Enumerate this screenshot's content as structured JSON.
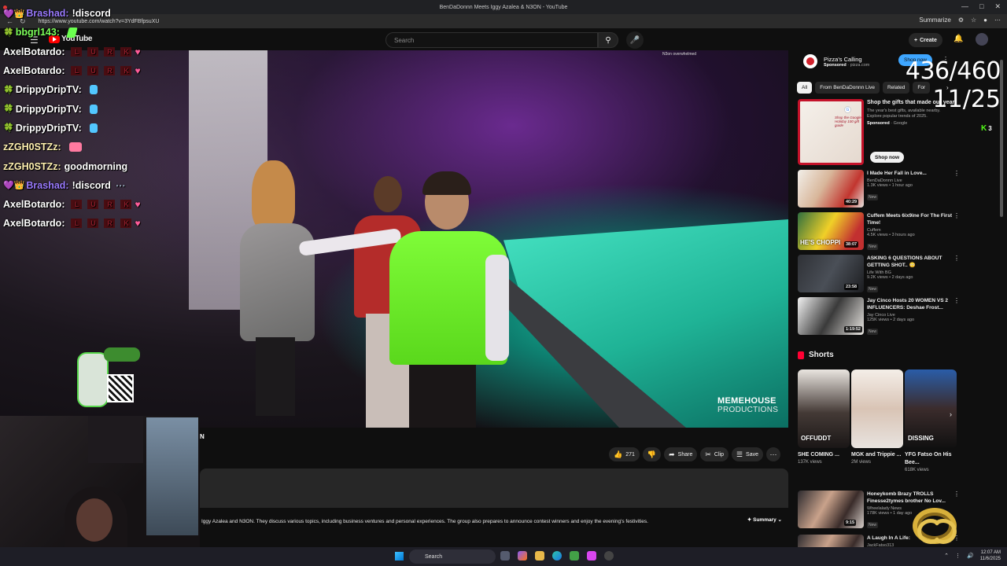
{
  "browser": {
    "tab_title": "BenDaDonnn Meets Iggy Azalea & N3ON - YouTube",
    "url": "https://www.youtube.com/watch?v=3YdFBfpsuXU",
    "summarize_label": "Summarize"
  },
  "youtube": {
    "logo_text": "YouTube",
    "search_placeholder": "Search",
    "create_label": "Create"
  },
  "video": {
    "overlay_text": "N3on overwhelmed",
    "watermark_line1": "MEMEHOUSE",
    "watermark_line2": "PRODUCTIONS",
    "title_fragment": "N",
    "likes": "271",
    "share_label": "Share",
    "clip_label": "Clip",
    "save_label": "Save",
    "summary_text": "Iggy Azalea and N3ON. They discuss various topics, including business ventures and personal experiences. The group also prepares to announce contest winners and enjoy the evening's festivities.",
    "summary_button": "Summary"
  },
  "chat": [
    {
      "user": "Brashad:",
      "msg": "!discord",
      "color": "#9b7bff",
      "badges": "💜👑",
      "emote": ""
    },
    {
      "user": "bbgrl143:",
      "msg": "",
      "color": "#7dff5a",
      "badges": "🍀",
      "emote": "green"
    },
    {
      "user": "AxelBotardo:",
      "msg": "",
      "color": "#ffffff",
      "badges": "",
      "emote": "lurk"
    },
    {
      "user": "AxelBotardo:",
      "msg": "",
      "color": "#ffffff",
      "badges": "",
      "emote": "lurk"
    },
    {
      "user": "DrippyDripTV:",
      "msg": "",
      "color": "#ffffff",
      "badges": "🍀",
      "emote": "cyan"
    },
    {
      "user": "DrippyDripTV:",
      "msg": "",
      "color": "#ffffff",
      "badges": "🍀",
      "emote": "cyan"
    },
    {
      "user": "DrippyDripTV:",
      "msg": "",
      "color": "#ffffff",
      "badges": "🍀",
      "emote": "cyan"
    },
    {
      "user": "zZGH0STZz:",
      "msg": "",
      "color": "#fff0b0",
      "badges": "",
      "emote": "sticker"
    },
    {
      "user": "zZGH0STZz:",
      "msg": "goodmorning",
      "color": "#fff0b0",
      "badges": "",
      "emote": ""
    },
    {
      "user": "Brashad:",
      "msg": "!discord",
      "color": "#9b7bff",
      "badges": "💜👑",
      "emote": "dots"
    },
    {
      "user": "AxelBotardo:",
      "msg": "",
      "color": "#ffffff",
      "badges": "",
      "emote": "lurk"
    },
    {
      "user": "AxelBotardo:",
      "msg": "",
      "color": "#ffffff",
      "badges": "",
      "emote": "lurk"
    }
  ],
  "lurk_letters": [
    "L",
    "U",
    "R",
    "K"
  ],
  "sidebar": {
    "ad1": {
      "title": "Pizza's Calling",
      "sponsored": "Sponsored",
      "domain": "pizza.com",
      "cta": "Shop now"
    },
    "chips": [
      "All",
      "From BenDaDonnn Live",
      "Related",
      "For"
    ],
    "ad2": {
      "title": "Shop the gifts that made our year",
      "desc": "The year's best gifts, available nearby. Explore popular trends of 2025.",
      "sponsored": "Sponsored",
      "advertiser": "Google",
      "cta": "Shop now",
      "thumb_text": "Shop the Google Holiday 100 gift guide"
    },
    "recs": [
      {
        "title": "I Made Her Fall in Love...",
        "channel": "BenDaDonnn Live",
        "meta": "1.3K views • 1 hour ago",
        "badge": "New",
        "duration": "40:29",
        "thumb_text": ""
      },
      {
        "title": "Cuffem Meets 6ix9ine For The First Time!",
        "channel": "Cuffem",
        "meta": "4.5K views • 3 hours ago",
        "badge": "New",
        "duration": "38:07",
        "thumb_text": "HE'S CHOPPI"
      },
      {
        "title": "ASKING 6 QUESTIONS ABOUT GETTING SHOT.. 😳",
        "channel": "Life With BG",
        "meta": "9.2K views • 2 days ago",
        "badge": "New",
        "duration": "23:58",
        "thumb_text": ""
      },
      {
        "title": "Jay Cinco Hosts 20 WOMEN VS 2 INFLUENCERS: Deshae Frost...",
        "channel": "Jay Cinco Live",
        "meta": "125K views • 2 days ago",
        "badge": "New",
        "duration": "1:19:52",
        "thumb_text": ""
      }
    ],
    "shorts_title": "Shorts",
    "shorts": [
      {
        "title": "SHE COMING ...",
        "views": "137K views",
        "thumb_text": "OFFUDDT"
      },
      {
        "title": "MGK and Trippie ...",
        "views": "2M views",
        "thumb_text": ""
      },
      {
        "title": "YFG Fatso On His Bee...",
        "views": "618K views",
        "thumb_text": "DISSING"
      }
    ],
    "bottom_recs": [
      {
        "title": "Honeykomb Brazy TROLLS Finesse2tymes brother No Lov...",
        "channel": "Wheelalady News",
        "meta": "178K views • 1 day ago",
        "badge": "New",
        "duration": "9:15"
      },
      {
        "title": "A Laugh In A Life:",
        "channel": "JackFatso313",
        "meta": "",
        "badge": "",
        "duration": ""
      }
    ]
  },
  "overlay": {
    "counter_a": "436/460",
    "counter_b": "11/25",
    "kick_count": "3"
  },
  "taskbar": {
    "search_label": "Search",
    "time": "12:07 AM",
    "date": "11/6/2025"
  }
}
